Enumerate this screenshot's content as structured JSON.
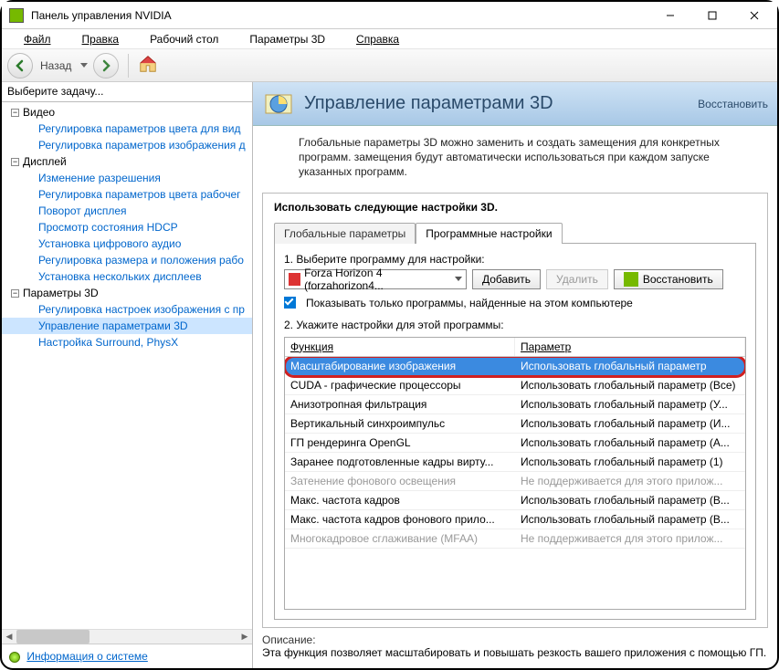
{
  "titlebar": {
    "title": "Панель управления NVIDIA"
  },
  "menu": {
    "file": "Файл",
    "edit": "Правка",
    "desk": "Рабочий стол",
    "p3d": "Параметры 3D",
    "help": "Справка"
  },
  "toolbar": {
    "back": "Назад"
  },
  "sidebar": {
    "header": "Выберите задачу...",
    "video": "Видео",
    "video_items": [
      "Регулировка параметров цвета для вид",
      "Регулировка параметров изображения д"
    ],
    "display": "Дисплей",
    "display_items": [
      "Изменение разрешения",
      "Регулировка параметров цвета рабочег",
      "Поворот дисплея",
      "Просмотр состояния HDCP",
      "Установка цифрового аудио",
      "Регулировка размера и положения рабо",
      "Установка нескольких дисплеев"
    ],
    "p3d": "Параметры 3D",
    "p3d_items": [
      "Регулировка настроек изображения с пр",
      "Управление параметрами 3D",
      "Настройка Surround, PhysX"
    ],
    "sysinfo": "Информация о системе"
  },
  "main": {
    "title": "Управление параметрами 3D",
    "restore": "Восстановить",
    "desc": "Глобальные параметры 3D можно заменить и создать замещения для конкретных программ. замещения будут автоматически использоваться при каждом запуске указанных программ.",
    "settings_title": "Использовать следующие настройки 3D.",
    "tab_global": "Глобальные параметры",
    "tab_program": "Программные настройки",
    "step1": "1. Выберите программу для настройки:",
    "program": "Forza Horizon 4 (forzahorizon4...",
    "add": "Добавить",
    "delete": "Удалить",
    "restore2": "Восстановить",
    "showonly": "Показывать только программы, найденные на этом компьютере",
    "step2": "2. Укажите настройки для этой программы:",
    "col_func": "Функция",
    "col_param": "Параметр",
    "rows": [
      {
        "f": "Масштабирование изображения",
        "p": "Использовать глобальный параметр",
        "hl": true
      },
      {
        "f": "CUDA - графические процессоры",
        "p": "Использовать глобальный параметр (Все)"
      },
      {
        "f": "Анизотропная фильтрация",
        "p": "Использовать глобальный параметр (У..."
      },
      {
        "f": "Вертикальный синхроимпульс",
        "p": "Использовать глобальный параметр (И..."
      },
      {
        "f": "ГП рендеринга OpenGL",
        "p": "Использовать глобальный параметр (А..."
      },
      {
        "f": "Заранее подготовленные кадры вирту...",
        "p": "Использовать глобальный параметр (1)"
      },
      {
        "f": "Затенение фонового освещения",
        "p": "Не поддерживается для этого прилож...",
        "dis": true
      },
      {
        "f": "Макс. частота кадров",
        "p": "Использовать глобальный параметр (В..."
      },
      {
        "f": "Макс. частота кадров фонового прило...",
        "p": "Использовать глобальный параметр (В..."
      },
      {
        "f": "Многокадровое сглаживание (MFAA)",
        "p": "Не поддерживается для этого прилож...",
        "dis": true
      }
    ],
    "footer_title": "Описание:",
    "footer_text": "Эта функция позволяет масштабировать и повышать резкость вашего приложения с помощью ГП."
  }
}
